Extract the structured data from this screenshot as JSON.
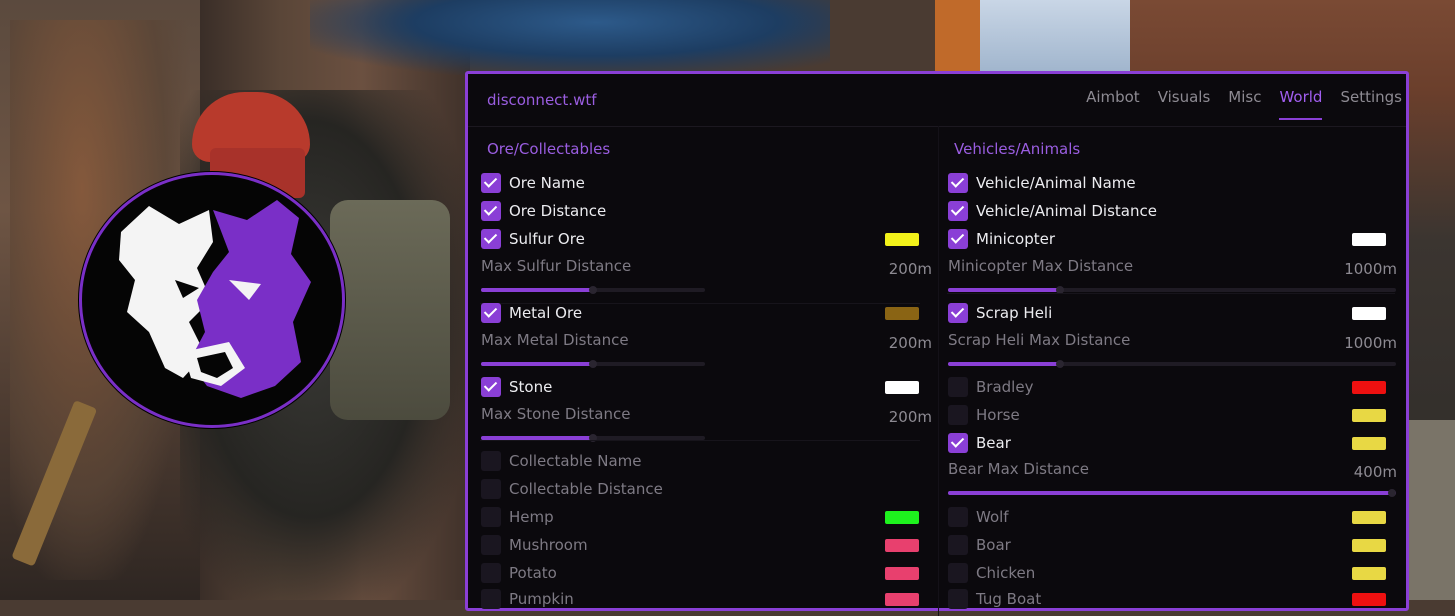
{
  "app": {
    "brand": "disconnect.wtf",
    "tabs": [
      {
        "label": "Aimbot",
        "active": false
      },
      {
        "label": "Visuals",
        "active": false
      },
      {
        "label": "Misc",
        "active": false
      },
      {
        "label": "World",
        "active": true
      },
      {
        "label": "Settings",
        "active": false
      }
    ],
    "accent_color": "#8a3fd6"
  },
  "left": {
    "title": "Ore/Collectables",
    "ore_name": {
      "label": "Ore Name",
      "checked": true
    },
    "ore_distance": {
      "label": "Ore Distance",
      "checked": true
    },
    "sulfur": {
      "label": "Sulfur Ore",
      "checked": true,
      "color": "#f2f21a"
    },
    "sulfur_slider": {
      "label": "Max Sulfur Distance",
      "value": "200m",
      "fraction": 0.5
    },
    "metal": {
      "label": "Metal Ore",
      "checked": true,
      "color": "#8a6414"
    },
    "metal_slider": {
      "label": "Max Metal Distance",
      "value": "200m",
      "fraction": 0.5
    },
    "stone": {
      "label": "Stone",
      "checked": true,
      "color": "#ffffff"
    },
    "stone_slider": {
      "label": "Max Stone Distance",
      "value": "200m",
      "fraction": 0.5
    },
    "collectable_name": {
      "label": "Collectable Name",
      "checked": false
    },
    "collectable_distance": {
      "label": "Collectable Distance",
      "checked": false
    },
    "hemp": {
      "label": "Hemp",
      "checked": false,
      "color": "#1ef21e"
    },
    "mushroom": {
      "label": "Mushroom",
      "checked": false,
      "color": "#e8406e"
    },
    "potato": {
      "label": "Potato",
      "checked": false,
      "color": "#e8406e"
    },
    "pumpkin": {
      "label": "Pumpkin",
      "checked": false,
      "color": "#e8406e"
    }
  },
  "right": {
    "title": "Vehicles/Animals",
    "va_name": {
      "label": "Vehicle/Animal Name",
      "checked": true
    },
    "va_distance": {
      "label": "Vehicle/Animal Distance",
      "checked": true
    },
    "minicopter": {
      "label": "Minicopter",
      "checked": true,
      "color": "#ffffff"
    },
    "minicopter_slider": {
      "label": "Minicopter Max Distance",
      "value": "1000m",
      "fraction": 0.25
    },
    "scrap_heli": {
      "label": "Scrap Heli",
      "checked": true,
      "color": "#ffffff"
    },
    "scrap_slider": {
      "label": "Scrap Heli Max Distance",
      "value": "1000m",
      "fraction": 0.25
    },
    "bradley": {
      "label": "Bradley",
      "checked": false,
      "color": "#ee1010"
    },
    "horse": {
      "label": "Horse",
      "checked": false,
      "color": "#e8d844"
    },
    "bear": {
      "label": "Bear",
      "checked": true,
      "color": "#e8d844"
    },
    "bear_slider": {
      "label": "Bear Max Distance",
      "value": "400m",
      "fraction": 1.0
    },
    "wolf": {
      "label": "Wolf",
      "checked": false,
      "color": "#e8d844"
    },
    "boar": {
      "label": "Boar",
      "checked": false,
      "color": "#e8d844"
    },
    "chicken": {
      "label": "Chicken",
      "checked": false,
      "color": "#e8d844"
    },
    "tug_boat": {
      "label": "Tug Boat",
      "checked": false,
      "color": "#ee1010"
    }
  }
}
